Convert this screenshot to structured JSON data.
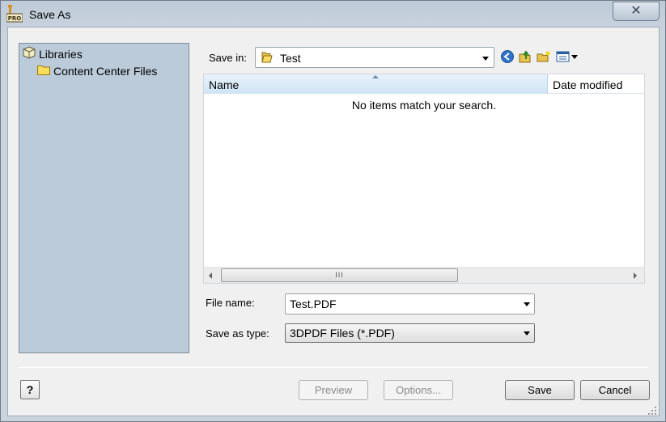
{
  "window": {
    "title": "Save As",
    "close_glyph": "✕",
    "app_icon": "inventor-pro-icon"
  },
  "sidebar": {
    "items": [
      {
        "label": "Libraries",
        "icon": "libraries-icon"
      },
      {
        "label": "Content Center Files",
        "icon": "folder-icon"
      }
    ]
  },
  "save_in": {
    "label": "Save in:",
    "value": "Test"
  },
  "toolbar": {
    "icons": [
      "back-icon",
      "up-folder-icon",
      "new-folder-icon",
      "views-menu-icon"
    ]
  },
  "file_list": {
    "columns": [
      "Name",
      "Date modified"
    ],
    "empty_message": "No items match your search.",
    "scroll_grip": "III"
  },
  "file_name": {
    "label": "File name:",
    "value": "Test.PDF"
  },
  "save_as_type": {
    "label": "Save as type:",
    "value": "3DPDF Files (*.PDF)"
  },
  "buttons": {
    "help": "?",
    "preview": "Preview",
    "options": "Options...",
    "save": "Save",
    "cancel": "Cancel"
  },
  "colors": {
    "sidebar_bg": "#bccbda",
    "title_bg": "#c6d1dd",
    "header_highlight": "#cfe4f6"
  }
}
